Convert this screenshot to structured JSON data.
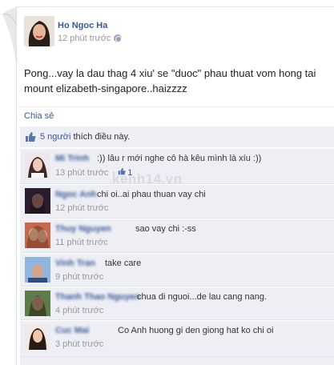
{
  "post": {
    "author": "Ho Ngoc Ha",
    "time": "12 phút trước",
    "status_line1": "Pong...vay la dau thag 4 xiu' se \"duoc\" phau thuat vom hong tai",
    "status_line2": "mount elizabeth-singapore..haizzzz",
    "share_label": "Chia sẻ"
  },
  "likes": {
    "count_text": "5 người",
    "suffix": " thích điều này."
  },
  "comments": [
    {
      "name": "Mi Trinh",
      "text": ":)) lâu r mới nghe cô hà kêu mình là xíu :))",
      "time": "13 phút trước",
      "likes": "1"
    },
    {
      "name": "Ngoc Anh",
      "text": "chi oi..ai phau thuan vay chi",
      "time": "12 phút trước"
    },
    {
      "name": "Thuy Nguyen",
      "text": "sao vay chi :-ss",
      "time": "11 phút trước"
    },
    {
      "name": "Vinh Tran",
      "text": "take care",
      "time": "9 phút trước"
    },
    {
      "name": "Thanh Thao Nguyen",
      "text": "chua di nguoi...de lau cang nang.",
      "time": "4 phút trước"
    },
    {
      "name": "Cuc Mai",
      "text": "Co Anh huong gi den giong hat ko chi oi",
      "time": "3 phút trước"
    }
  ],
  "watermark": "kenh14.vn",
  "colors": {
    "link": "#3b5998",
    "ufi_bg": "#edeff4",
    "meta": "#999999"
  },
  "icons": {
    "thumb": "thumbs-up-icon",
    "globe": "globe-icon"
  }
}
